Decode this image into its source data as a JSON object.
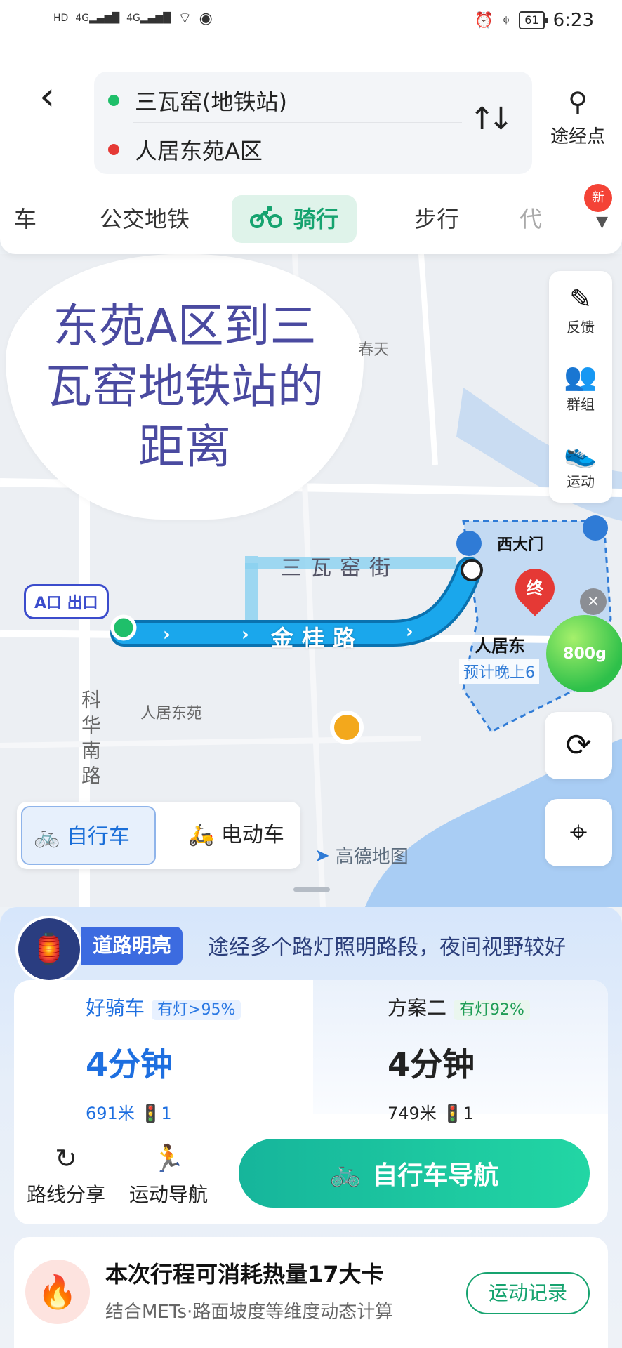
{
  "status_bar": {
    "left_icons": [
      "HD",
      "4G",
      "4G",
      "wifi-icon",
      "eye-icon"
    ],
    "battery": "61",
    "time": "6:23"
  },
  "route": {
    "from": "三瓦窑(地铁站)",
    "to": "人居东苑A区",
    "waypoint_label": "途经点",
    "from_color": "#1fbf6a",
    "to_color": "#e53935"
  },
  "tabs": {
    "items": [
      {
        "label": "车"
      },
      {
        "label": "公交地铁"
      },
      {
        "label": "骑行"
      },
      {
        "label": "步行"
      },
      {
        "label": "代"
      }
    ],
    "active": "骑行",
    "new_badge": "新"
  },
  "map": {
    "overlay_text": "东苑A区到三瓦窑地铁站的距离",
    "labels": {
      "chuntian": "春天",
      "keh_hua_nan_lu": "科华南路",
      "renju_dongyuan": "人居东苑",
      "exit": "A口 出口",
      "street_top": "三瓦窑街",
      "street_main": "金桂路",
      "west_gate": "西大门",
      "destination": "人居东",
      "end_marker": "终",
      "eta": "预计晚上6",
      "weight": "800g"
    },
    "tools": [
      {
        "icon": "pen-icon",
        "label": "反馈"
      },
      {
        "icon": "group-icon",
        "label": "群组"
      },
      {
        "icon": "running-shoe-icon",
        "label": "运动"
      }
    ],
    "mode_switch": {
      "active": "自行车",
      "other": "电动车"
    },
    "logo": "高德地图",
    "route_color": "#1aa7ec"
  },
  "sheet": {
    "light_label": "道路明亮",
    "light_desc": "途经多个路灯照明路段，夜间视野较好",
    "plans": [
      {
        "name": "好骑车",
        "tag": "有灯>95%",
        "time": "4分钟",
        "distance": "691米",
        "lights": "1"
      },
      {
        "name": "方案二",
        "tag": "有灯92%",
        "time": "4分钟",
        "distance": "749米",
        "lights": "1"
      }
    ],
    "actions": [
      {
        "icon": "share-icon",
        "label": "路线分享"
      },
      {
        "icon": "sport-nav-icon",
        "label": "运动导航"
      }
    ],
    "nav_button": "自行车导航",
    "calorie_title": "本次行程可消耗热量17大卡",
    "calorie_sub": "结合METs·路面坡度等维度动态计算",
    "record_button": "运动记录"
  }
}
